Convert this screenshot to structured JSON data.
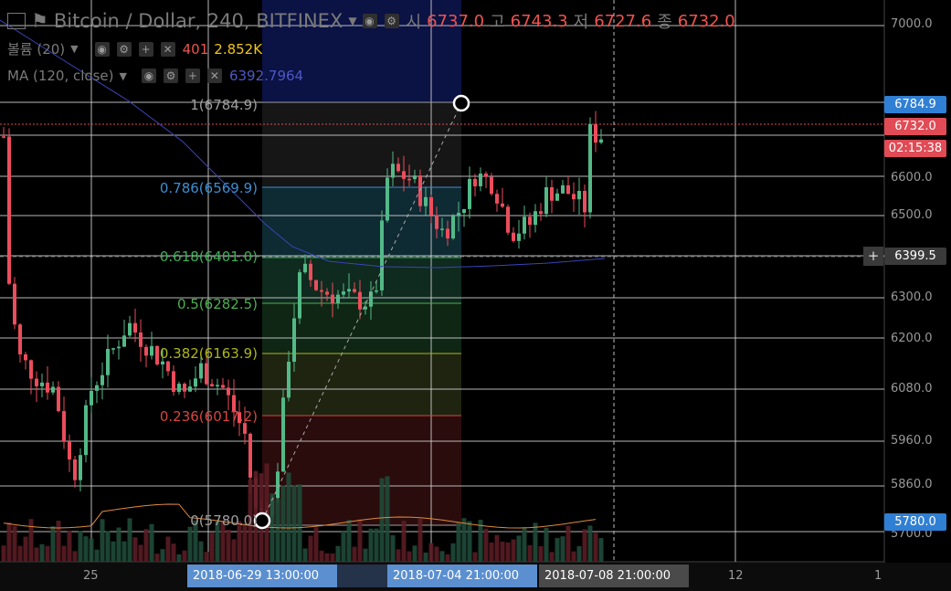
{
  "symbol": {
    "title": "Bitcoin / Dollar, 240, BITFINEX",
    "ohlc": [
      {
        "label": "시",
        "value": "6737.0"
      },
      {
        "label": "고",
        "value": "6743.3"
      },
      {
        "label": "저",
        "value": "6727.6"
      },
      {
        "label": "종",
        "value": "6732.0"
      }
    ]
  },
  "volume_indicator": {
    "name": "볼륨 (20)",
    "value1": "401",
    "value2": "2.852K"
  },
  "ma_indicator": {
    "name": "MA (120, close)",
    "value": "6392.7964"
  },
  "price_axis": {
    "ticks": [
      "7000.0",
      "6600.0",
      "6500.0",
      "6300.0",
      "6200.0",
      "6080.0",
      "5960.0",
      "5860.0",
      "5700.0"
    ],
    "tag_high": "6784.9",
    "tag_last": "6732.0",
    "tag_countdown": "02:15:38",
    "tag_cross": "6399.5",
    "tag_low": "5780.0"
  },
  "time_axis": {
    "labels": [
      "25",
      "12",
      "1"
    ],
    "selected": [
      "2018-06-29 13:00:00",
      "2018-07-04 21:00:00",
      "2018-07-08 21:00:00"
    ]
  },
  "fib_levels": [
    {
      "label": "1(6784.9)",
      "color": "#9e9e9e"
    },
    {
      "label": "0.786(6569.9)",
      "color": "#3e8ed0"
    },
    {
      "label": "0.618(6401.0)",
      "color": "#3fae5a"
    },
    {
      "label": "0.5(6282.5)",
      "color": "#4caf50"
    },
    {
      "label": "0.382(6163.9)",
      "color": "#aeb51a"
    },
    {
      "label": "0.236(6017.2)",
      "color": "#d64541"
    },
    {
      "label": "0(5780.0)",
      "color": "#9e9e9e"
    }
  ],
  "colors": {
    "up": "#53b987",
    "down": "#eb4d5c",
    "ma": "#3a45b8",
    "volume_ma": "#e08a3c"
  }
}
